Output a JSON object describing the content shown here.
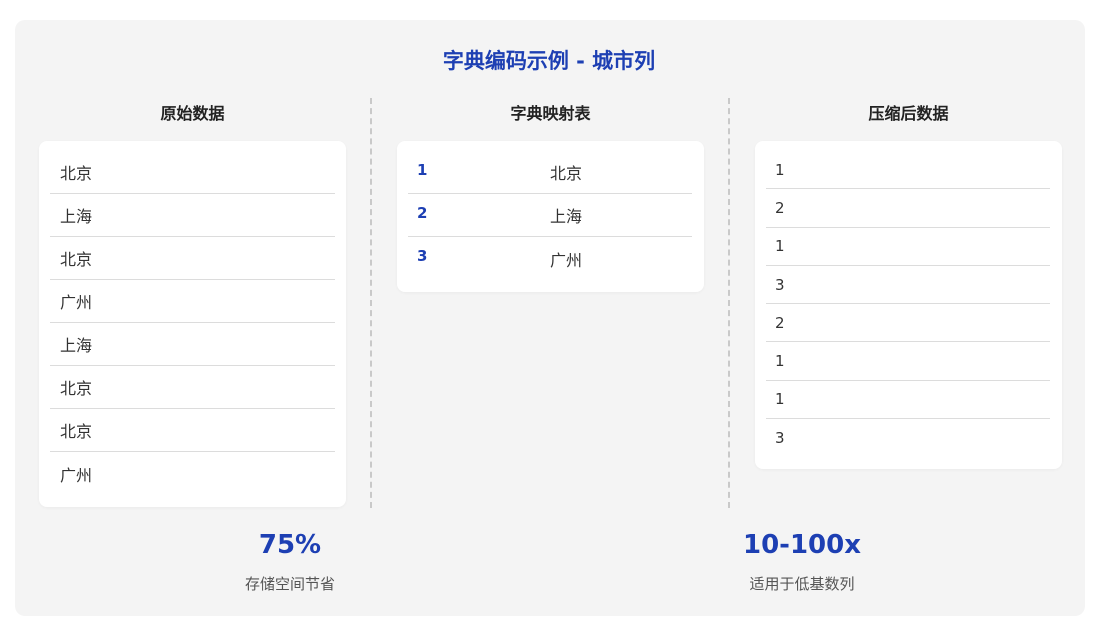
{
  "title": "字典编码示例 - 城市列",
  "columns": {
    "original": {
      "heading": "原始数据",
      "values": [
        "北京",
        "上海",
        "北京",
        "广州",
        "上海",
        "北京",
        "北京",
        "广州"
      ]
    },
    "dictionary": {
      "heading": "字典映射表",
      "entries": [
        {
          "code": "1",
          "value": "北京"
        },
        {
          "code": "2",
          "value": "上海"
        },
        {
          "code": "3",
          "value": "广州"
        }
      ]
    },
    "compressed": {
      "heading": "压缩后数据",
      "values": [
        "1",
        "2",
        "1",
        "3",
        "2",
        "1",
        "1",
        "3"
      ]
    }
  },
  "stats": [
    {
      "value": "75%",
      "label": "存储空间节省"
    },
    {
      "value": "10-100x",
      "label": "适用于低基数列"
    }
  ],
  "colors": {
    "accent": "#1d3fb3",
    "background": "#f4f4f4",
    "card": "#ffffff"
  }
}
